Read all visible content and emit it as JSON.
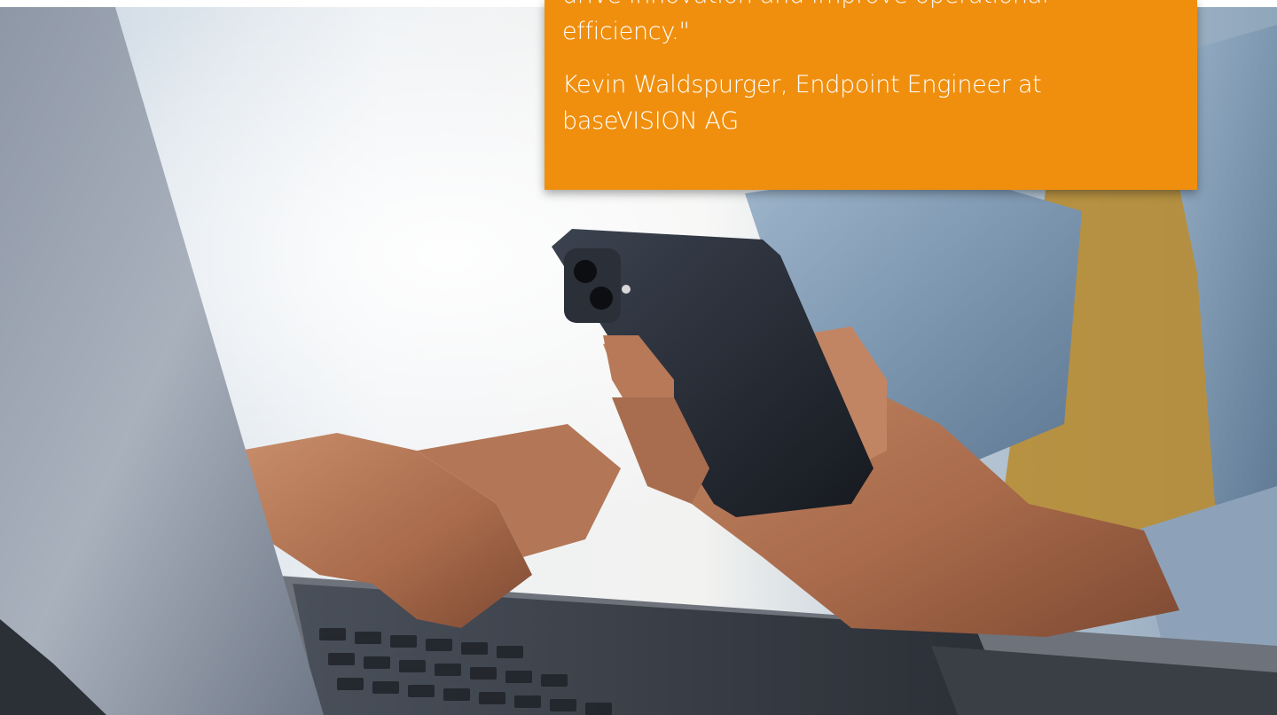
{
  "testimonial": {
    "quote_partial_line": "drive innovation and improve operational",
    "quote_last_line": "efficiency.\"",
    "author_line_1": "Kevin Waldspurger, Endpoint Engineer at",
    "author_line_2": "baseVISION AG"
  },
  "colors": {
    "card_background": "#f08f0e",
    "card_text": "#ffffff"
  }
}
